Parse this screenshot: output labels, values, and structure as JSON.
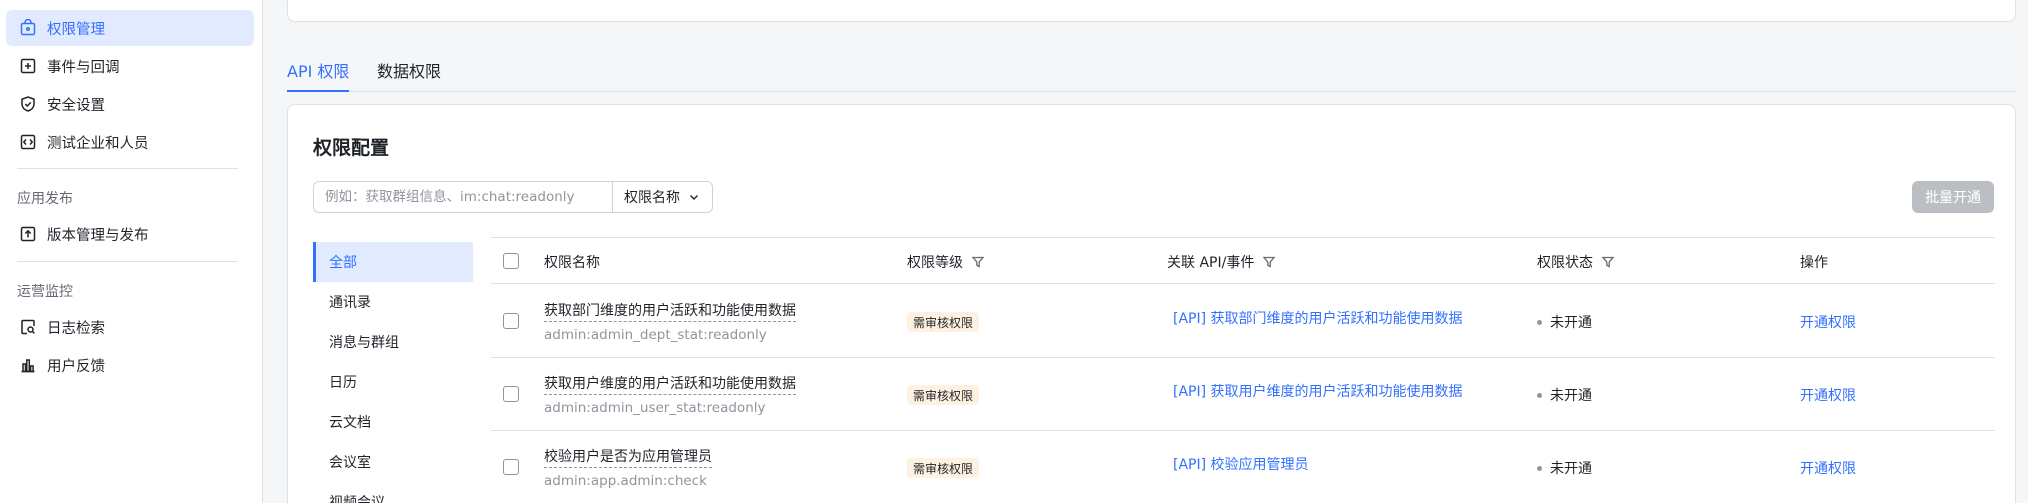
{
  "sidebar": {
    "items": [
      {
        "label": "权限管理",
        "icon": "lock-box-icon",
        "active": true
      },
      {
        "label": "事件与回调",
        "icon": "plus-box-icon"
      },
      {
        "label": "安全设置",
        "icon": "shield-check-icon"
      },
      {
        "label": "测试企业和人员",
        "icon": "code-box-icon"
      }
    ],
    "group_publish": "应用发布",
    "publish_items": [
      {
        "label": "版本管理与发布",
        "icon": "upload-box-icon"
      }
    ],
    "group_ops": "运营监控",
    "ops_items": [
      {
        "label": "日志检索",
        "icon": "log-search-icon"
      },
      {
        "label": "用户反馈",
        "icon": "bar-chart-icon"
      }
    ]
  },
  "tabs": [
    {
      "label": "API 权限",
      "active": true
    },
    {
      "label": "数据权限"
    }
  ],
  "card": {
    "title": "权限配置",
    "search": {
      "placeholder": "例如：获取群组信息、im:chat:readonly",
      "select_value": "权限名称"
    },
    "batch_button": "批量开通",
    "categories": [
      "全部",
      "通讯录",
      "消息与群组",
      "日历",
      "云文档",
      "会议室",
      "视频会议"
    ],
    "columns": {
      "name": "权限名称",
      "level": "权限等级",
      "api": "关联 API/事件",
      "status": "权限状态",
      "action": "操作"
    },
    "rows": [
      {
        "name": "获取部门维度的用户活跃和功能使用数据",
        "code": "admin:admin_dept_stat:readonly",
        "level": "需审核权限",
        "api": "[API] 获取部门维度的用户活跃和功能使用数据",
        "status": "未开通",
        "action": "开通权限"
      },
      {
        "name": "获取用户维度的用户活跃和功能使用数据",
        "code": "admin:admin_user_stat:readonly",
        "level": "需审核权限",
        "api": "[API] 获取用户维度的用户活跃和功能使用数据",
        "status": "未开通",
        "action": "开通权限"
      },
      {
        "name": "校验用户是否为应用管理员",
        "code": "admin:app.admin:check",
        "level": "需审核权限",
        "api": "[API] 校验应用管理员",
        "status": "未开通",
        "action": "开通权限"
      }
    ]
  },
  "colors": {
    "accent": "#3370ff",
    "active_bg": "#e1eaff",
    "tag_bg": "#fef1e1",
    "disabled_button": "#bbbfc4"
  }
}
